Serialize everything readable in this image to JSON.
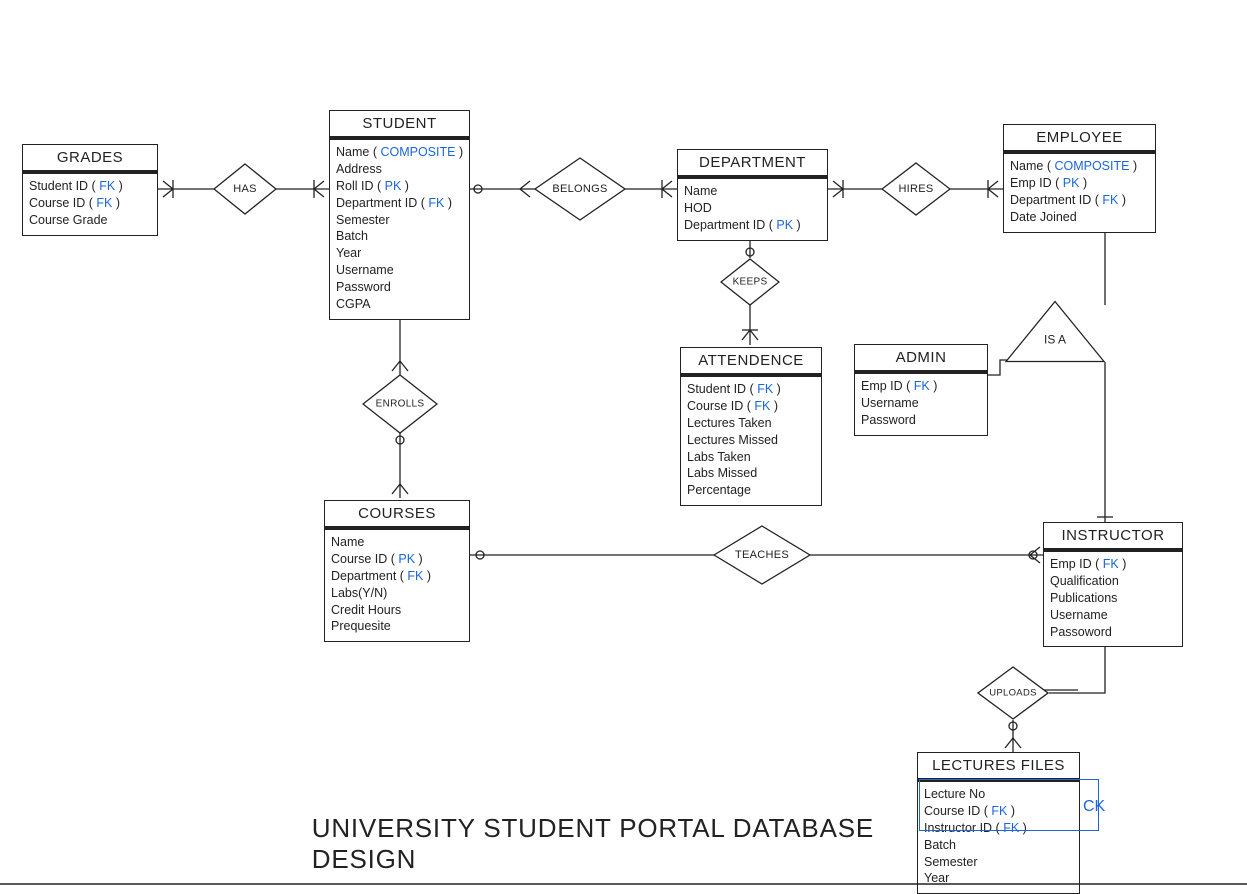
{
  "title": "UNIVERSITY STUDENT PORTAL DATABASE DESIGN",
  "keys": {
    "pk": "PK",
    "fk": "FK",
    "composite": "COMPOSITE",
    "ck": "CK"
  },
  "entities": {
    "grades": {
      "title": "GRADES",
      "attrs": [
        {
          "label": "Student ID",
          "key": "fk"
        },
        {
          "label": "Course ID",
          "key": "fk"
        },
        {
          "label": "Course Grade"
        }
      ]
    },
    "student": {
      "title": "STUDENT",
      "attrs": [
        {
          "label": "Name",
          "key": "composite"
        },
        {
          "label": "Address"
        },
        {
          "label": "Roll ID",
          "key": "pk"
        },
        {
          "label": "Department ID",
          "key": "fk"
        },
        {
          "label": "Semester"
        },
        {
          "label": "Batch"
        },
        {
          "label": "Year"
        },
        {
          "label": "Username"
        },
        {
          "label": "Password"
        },
        {
          "label": "CGPA"
        }
      ]
    },
    "department": {
      "title": "DEPARTMENT",
      "attrs": [
        {
          "label": "Name"
        },
        {
          "label": "HOD"
        },
        {
          "label": "Department ID",
          "key": "pk"
        }
      ]
    },
    "employee": {
      "title": "EMPLOYEE",
      "attrs": [
        {
          "label": "Name",
          "key": "composite"
        },
        {
          "label": "Emp ID",
          "key": "pk"
        },
        {
          "label": "Department ID",
          "key": "fk"
        },
        {
          "label": "Date Joined"
        }
      ]
    },
    "attendence": {
      "title": "ATTENDENCE",
      "attrs": [
        {
          "label": "Student ID",
          "key": "fk"
        },
        {
          "label": "Course ID",
          "key": "fk"
        },
        {
          "label": "Lectures Taken"
        },
        {
          "label": "Lectures Missed"
        },
        {
          "label": "Labs Taken"
        },
        {
          "label": "Labs Missed"
        },
        {
          "label": "Percentage"
        }
      ]
    },
    "admin": {
      "title": "ADMIN",
      "attrs": [
        {
          "label": "Emp ID",
          "key": "fk"
        },
        {
          "label": "Username"
        },
        {
          "label": "Password"
        }
      ]
    },
    "courses": {
      "title": "COURSES",
      "attrs": [
        {
          "label": "Name"
        },
        {
          "label": "Course ID",
          "key": "pk"
        },
        {
          "label": "Department",
          "key": "fk"
        },
        {
          "label": "Labs(Y/N)"
        },
        {
          "label": "Credit Hours"
        },
        {
          "label": "Prequesite"
        }
      ]
    },
    "instructor": {
      "title": "INSTRUCTOR",
      "attrs": [
        {
          "label": "Emp ID",
          "key": "fk"
        },
        {
          "label": "Qualification"
        },
        {
          "label": "Publications"
        },
        {
          "label": "Username"
        },
        {
          "label": "Passoword"
        }
      ]
    },
    "lectures_files": {
      "title": "LECTURES FILES",
      "attrs": [
        {
          "label": "Lecture No"
        },
        {
          "label": "Course ID",
          "key": "fk"
        },
        {
          "label": "Instructor ID",
          "key": "fk"
        },
        {
          "label": "Batch"
        },
        {
          "label": "Semester"
        },
        {
          "label": "Year"
        }
      ]
    }
  },
  "relationships": {
    "has": "HAS",
    "belongs": "BELONGS",
    "hires": "HIRES",
    "keeps": "KEEPS",
    "enrolls": "ENROLLS",
    "teaches": "TEACHES",
    "uploads": "UPLOADS",
    "isa": "IS A"
  }
}
